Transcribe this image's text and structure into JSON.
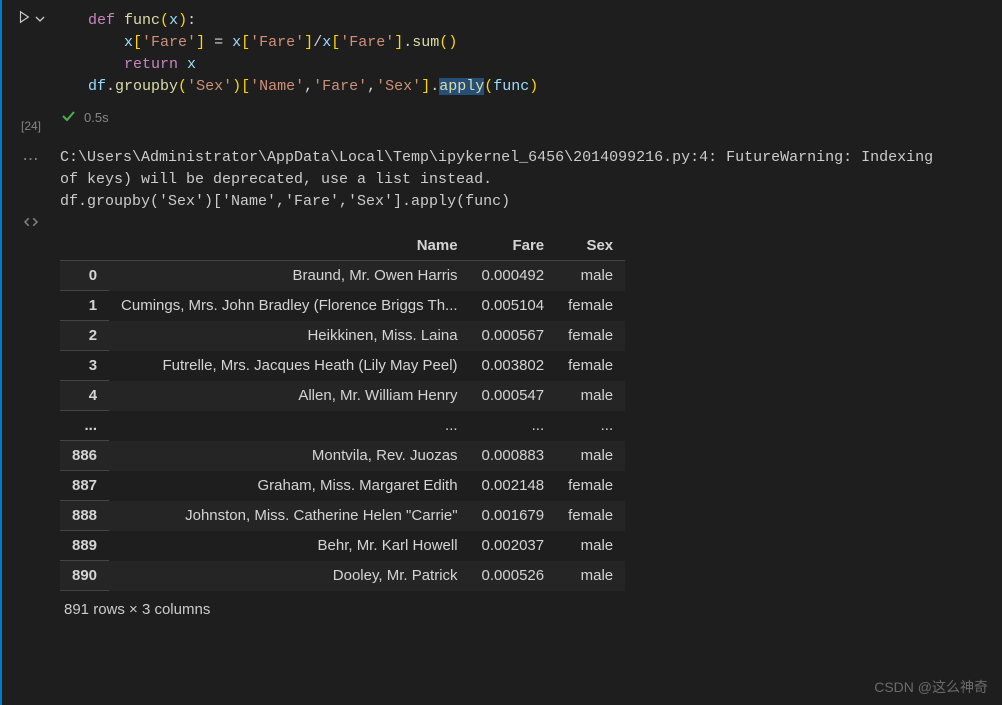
{
  "cell": {
    "exec_count": "[24]",
    "elapsed": "0.5s"
  },
  "code": {
    "l1_def": "def",
    "l1_fn": "func",
    "l1_arg": "x",
    "l2_x": "x",
    "l2_fare": "'Fare'",
    "l2_sum": "sum",
    "l3_ret": "return",
    "l3_x": "x",
    "l4_df": "df",
    "l4_groupby": "groupby",
    "l4_sex": "'Sex'",
    "l4_name": "'Name'",
    "l4_fare": "'Fare'",
    "l4_sex2": "'Sex'",
    "l4_apply": "apply",
    "l4_func": "func"
  },
  "warning": {
    "line1": "C:\\Users\\Administrator\\AppData\\Local\\Temp\\ipykernel_6456\\2014099216.py:4: FutureWarning: Indexing ",
    "line2": "of keys) will be deprecated, use a list instead.",
    "line3": "  df.groupby('Sex')['Name','Fare','Sex'].apply(func)"
  },
  "table": {
    "columns": [
      "",
      "Name",
      "Fare",
      "Sex"
    ],
    "rows": [
      [
        "0",
        "Braund, Mr. Owen Harris",
        "0.000492",
        "male"
      ],
      [
        "1",
        "Cumings, Mrs. John Bradley (Florence Briggs Th...",
        "0.005104",
        "female"
      ],
      [
        "2",
        "Heikkinen, Miss. Laina",
        "0.000567",
        "female"
      ],
      [
        "3",
        "Futrelle, Mrs. Jacques Heath (Lily May Peel)",
        "0.003802",
        "female"
      ],
      [
        "4",
        "Allen, Mr. William Henry",
        "0.000547",
        "male"
      ],
      [
        "...",
        "...",
        "...",
        "..."
      ],
      [
        "886",
        "Montvila, Rev. Juozas",
        "0.000883",
        "male"
      ],
      [
        "887",
        "Graham, Miss. Margaret Edith",
        "0.002148",
        "female"
      ],
      [
        "888",
        "Johnston, Miss. Catherine Helen \"Carrie\"",
        "0.001679",
        "female"
      ],
      [
        "889",
        "Behr, Mr. Karl Howell",
        "0.002037",
        "male"
      ],
      [
        "890",
        "Dooley, Mr. Patrick",
        "0.000526",
        "male"
      ]
    ],
    "shape": "891 rows × 3 columns"
  },
  "watermark": "CSDN @这么神奇"
}
